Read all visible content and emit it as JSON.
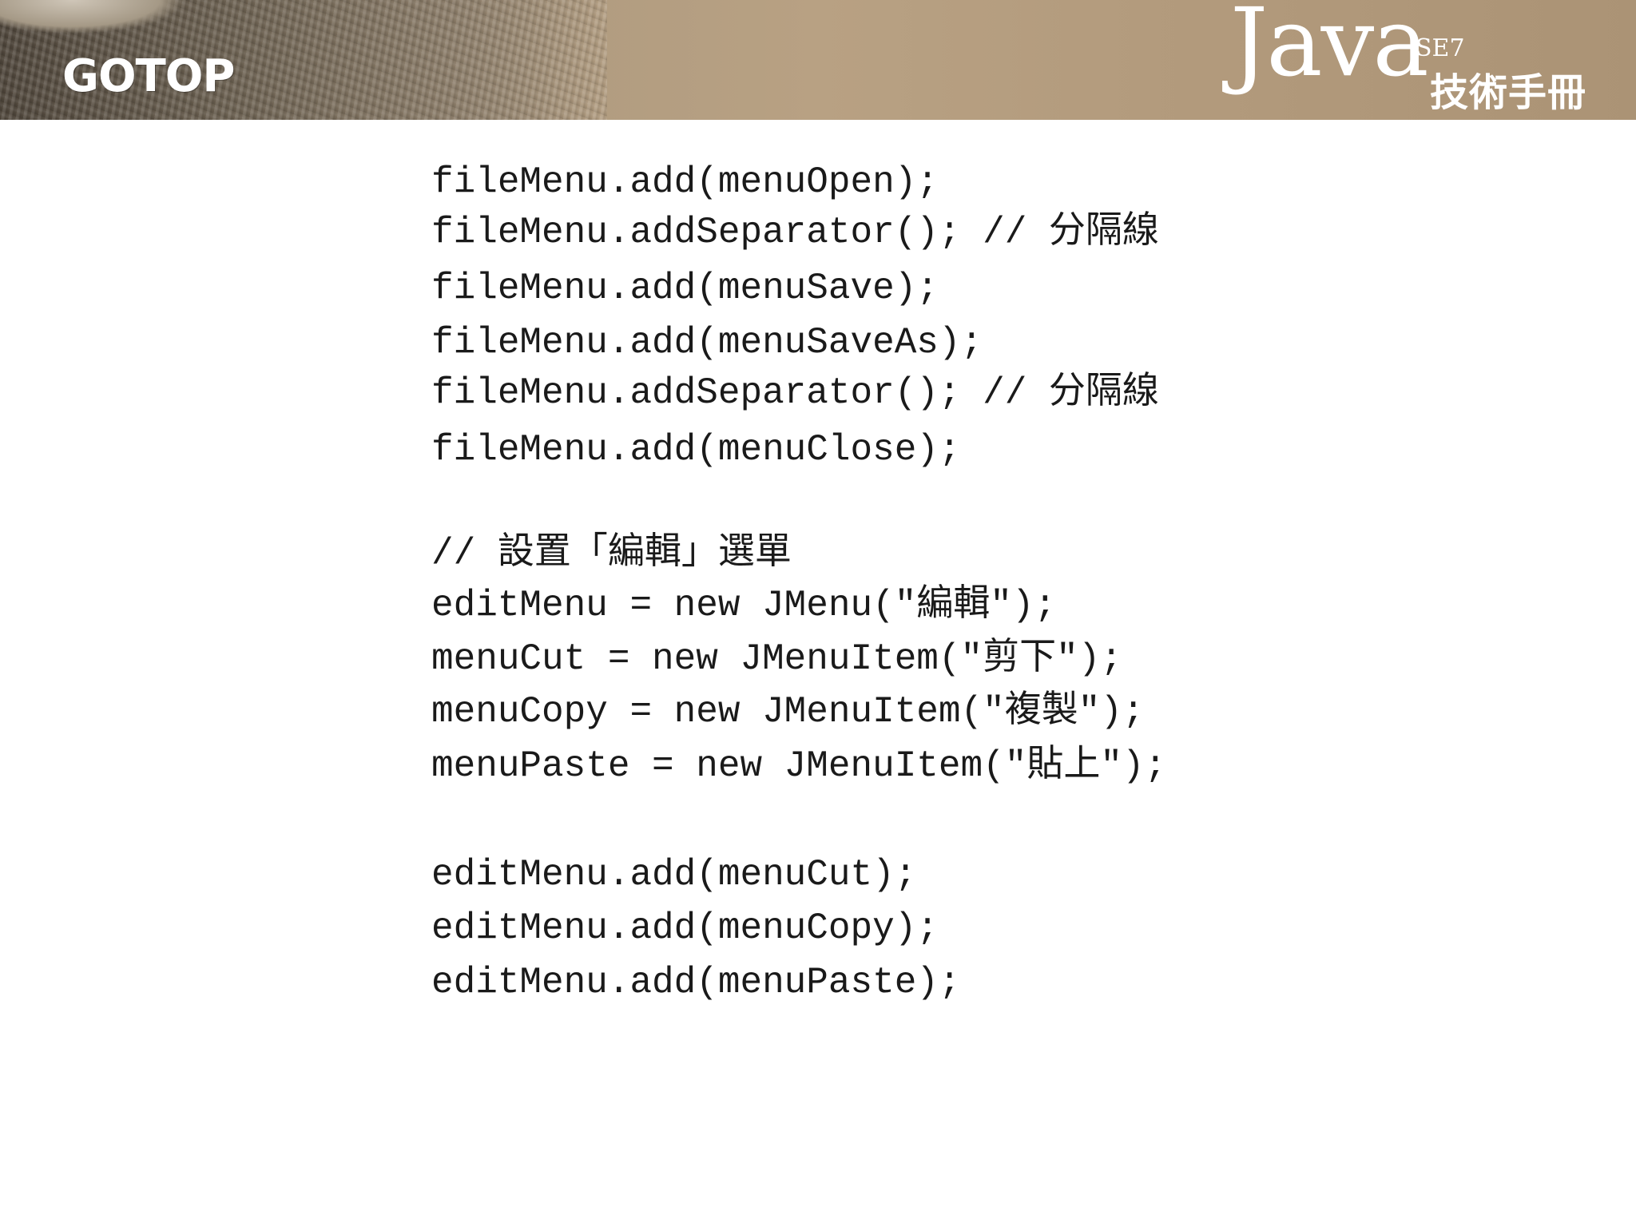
{
  "header": {
    "publisher_logo": "GOTOP",
    "book_title_main": "Java",
    "book_title_edition": "SE7",
    "book_title_sub": "技術手冊"
  },
  "code_lines": [
    "fileMenu.add(menuOpen);",
    "fileMenu.addSeparator(); // 分隔線",
    "fileMenu.add(menuSave);",
    "fileMenu.add(menuSaveAs);",
    "fileMenu.addSeparator(); // 分隔線",
    "fileMenu.add(menuClose);",
    "// 設置「編輯」選單",
    "editMenu = new JMenu(\"編輯\");",
    "menuCut = new JMenuItem(\"剪下\");",
    "menuCopy = new JMenuItem(\"複製\");",
    "menuPaste = new JMenuItem(\"貼上\");",
    "editMenu.add(menuCut);",
    "editMenu.add(menuCopy);",
    "editMenu.add(menuPaste);"
  ]
}
